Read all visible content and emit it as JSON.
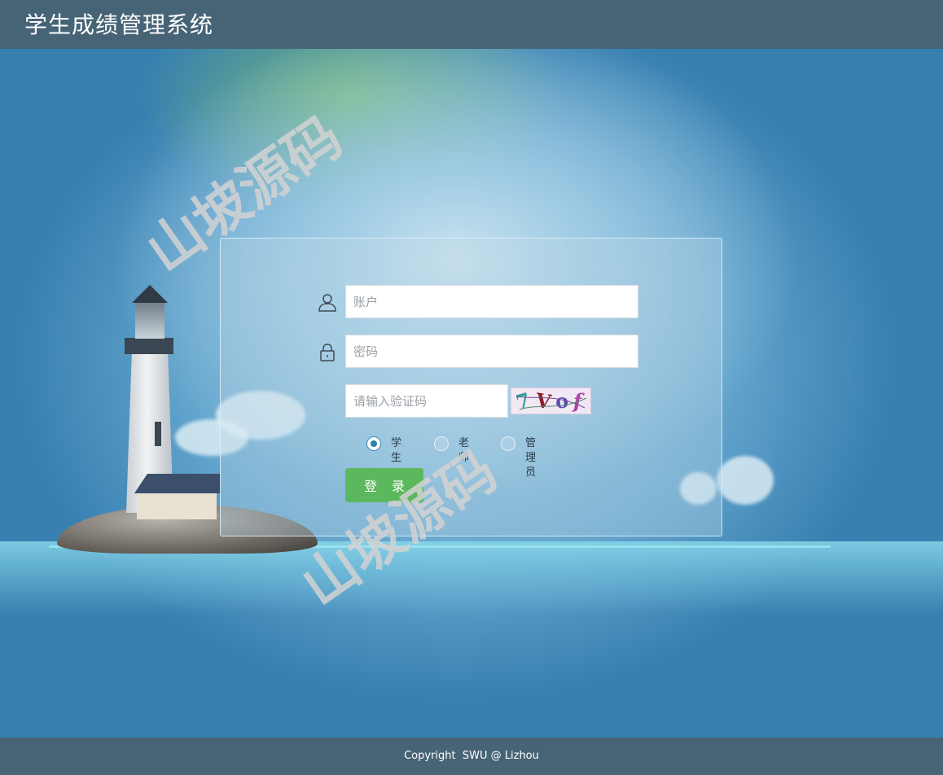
{
  "header": {
    "title": "学生成绩管理系统"
  },
  "watermark": {
    "text": "山坡源码"
  },
  "login": {
    "account_placeholder": "账户",
    "password_placeholder": "密码",
    "captcha_placeholder": "请输入验证码",
    "captcha_chars": [
      "7",
      "V",
      "o",
      "f"
    ],
    "roles": [
      {
        "label": "学生",
        "checked": true
      },
      {
        "label": "老师",
        "checked": false
      },
      {
        "label": "管理员",
        "checked": false
      }
    ],
    "submit_label": "登录"
  },
  "footer": {
    "copyright": "Copyright  SWU @ Lizhou"
  },
  "colors": {
    "bar": "#466476",
    "button": "#5cb85c",
    "radio_accent": "#2f7fb0"
  },
  "icons": {
    "account": "user-icon",
    "password": "lock-icon"
  }
}
